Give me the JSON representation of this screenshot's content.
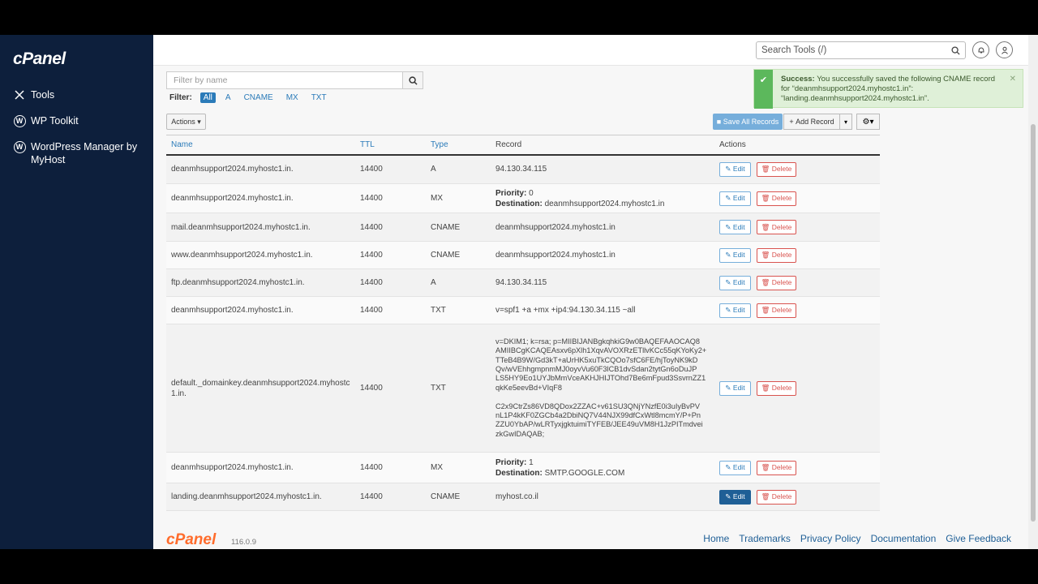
{
  "sidebar": {
    "logo": "cPanel",
    "items": [
      {
        "label": "Tools"
      },
      {
        "label": "WP Toolkit"
      },
      {
        "label": "WordPress Manager by MyHost"
      }
    ]
  },
  "topbar": {
    "search_placeholder": "Search Tools (/)"
  },
  "filter": {
    "placeholder": "Filter by name",
    "label": "Filter:",
    "chips": [
      "All",
      "A",
      "CNAME",
      "MX",
      "TXT"
    ]
  },
  "toolbar": {
    "actions_label": "Actions",
    "save_all_label": "Save All Records",
    "add_record_label": "Add Record"
  },
  "table": {
    "headers": {
      "name": "Name",
      "ttl": "TTL",
      "type": "Type",
      "record": "Record",
      "actions": "Actions"
    },
    "edit_label": "Edit",
    "delete_label": "Delete",
    "rows": [
      {
        "name": "deanmhsupport2024.myhostc1.in.",
        "ttl": "14400",
        "type": "A",
        "record": "94.130.34.115"
      },
      {
        "name": "deanmhsupport2024.myhostc1.in.",
        "ttl": "14400",
        "type": "MX",
        "priority_label": "Priority:",
        "priority": "0",
        "dest_label": "Destination:",
        "dest": "deanmhsupport2024.myhostc1.in"
      },
      {
        "name": "mail.deanmhsupport2024.myhostc1.in.",
        "ttl": "14400",
        "type": "CNAME",
        "record": "deanmhsupport2024.myhostc1.in"
      },
      {
        "name": "www.deanmhsupport2024.myhostc1.in.",
        "ttl": "14400",
        "type": "CNAME",
        "record": "deanmhsupport2024.myhostc1.in"
      },
      {
        "name": "ftp.deanmhsupport2024.myhostc1.in.",
        "ttl": "14400",
        "type": "A",
        "record": "94.130.34.115"
      },
      {
        "name": "deanmhsupport2024.myhostc1.in.",
        "ttl": "14400",
        "type": "TXT",
        "record": "v=spf1 +a +mx +ip4:94.130.34.115 ~all"
      },
      {
        "name": "default._domainkey.deanmhsupport2024.myhostc1.in.",
        "ttl": "14400",
        "type": "TXT",
        "record_lines": [
          "v=DKIM1; k=rsa; p=MIIBIJANBgkqhkiG9w0BAQEFAAOCAQ8",
          "AMIIBCgKCAQEAsxv6pXlh1XqvAVOXRzETllvKCc55qKYoKy2+",
          "TTeB4B9W/Gd3kT+aUrHK5xuTkCQOo7sfC6FE/hjToyNK9kD",
          "Qv/wVEhhgmpnmMJ0oyvVu60F3lCB1dvSdan2tytGn6oDuJP",
          "LS5HY9Eo1UYJbMmVceAKHJHIJTOhd7Be6mFpud3SsvrnZZ1",
          "qkKe5eevBd+VIqF8",
          "",
          "C2x9CtrZs86VD8QDox2ZZAC+v61SU3QNjYNzfE0i3uIyBvPV",
          "nL1P4kKF0ZGCb4a2DbiNQ7V44NJX99dfCxWtl8mcmY/P+Pn",
          "ZZU0YbAP/wLRTyxjgktuimiTYFEB/JEE49uVM8H1JzPITmdvei",
          "zkGwIDAQAB;"
        ]
      },
      {
        "name": "deanmhsupport2024.myhostc1.in.",
        "ttl": "14400",
        "type": "MX",
        "priority_label": "Priority:",
        "priority": "1",
        "dest_label": "Destination:",
        "dest": "SMTP.GOOGLE.COM"
      },
      {
        "name": "landing.deanmhsupport2024.myhostc1.in.",
        "ttl": "14400",
        "type": "CNAME",
        "record": "myhost.co.il"
      }
    ]
  },
  "toast": {
    "title": "Success:",
    "message": "You successfully saved the following CNAME record for “deanmhsupport2024.myhostc1.in”: “landing.deanmhsupport2024.myhostc1.in”."
  },
  "footer": {
    "logo": "cPanel",
    "version": "116.0.9",
    "links": [
      "Home",
      "Trademarks",
      "Privacy Policy",
      "Documentation",
      "Give Feedback"
    ]
  },
  "colors": {
    "sidebar_bg": "#0d1f3c",
    "link": "#2b7bb9",
    "danger": "#d9534f",
    "success": "#5cb85c",
    "brand_orange": "#ff6c2c"
  }
}
